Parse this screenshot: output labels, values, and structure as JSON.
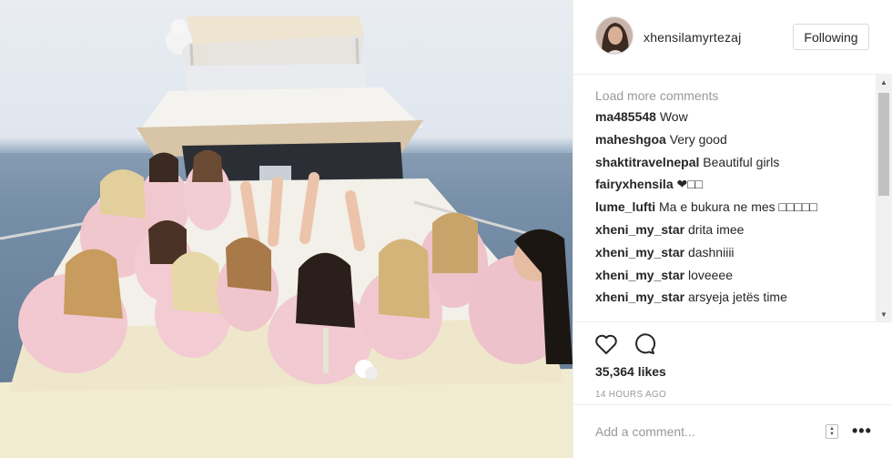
{
  "post": {
    "username": "xhensilamyrtezaj",
    "follow_label": "Following",
    "load_more": "Load more comments",
    "comments": [
      {
        "author": "ma485548",
        "text": "Wow"
      },
      {
        "author": "maheshgoa",
        "text": "Very good"
      },
      {
        "author": "shaktitravelnepal",
        "text": "Beautiful girls"
      },
      {
        "author": "fairyxhensila",
        "text": "❤□□"
      },
      {
        "author": "lume_lufti",
        "text": "Ma e bukura ne mes □□□□□"
      },
      {
        "author": "xheni_my_star",
        "text": "drita imee"
      },
      {
        "author": "xheni_my_star",
        "text": "dashniiii"
      },
      {
        "author": "xheni_my_star",
        "text": "loveeee"
      },
      {
        "author": "xheni_my_star",
        "text": "arsyeja jetës time"
      }
    ],
    "likes": "35,364 likes",
    "time": "14 HOURS AGO",
    "add_comment_placeholder": "Add a comment...",
    "more_label": "•••"
  },
  "colors": {
    "border": "#efefef",
    "muted": "#999999",
    "text": "#262626",
    "robe_pink": "#f0c8cf",
    "sea": "#7890a8"
  },
  "icons": [
    "heart-icon",
    "comment-bubble-icon",
    "sort-icon",
    "more-icon",
    "scroll-up-icon",
    "scroll-down-icon"
  ]
}
